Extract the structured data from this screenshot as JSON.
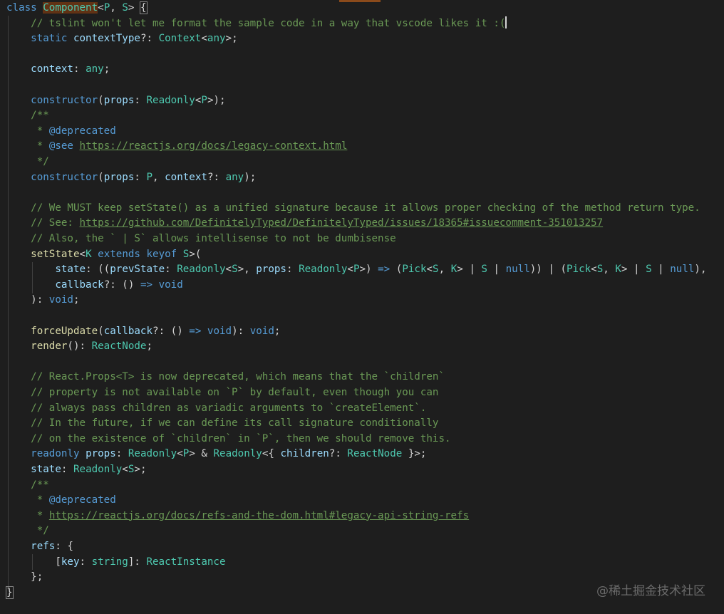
{
  "editor": {
    "lines": [
      [
        {
          "t": "class",
          "c": "kw"
        },
        {
          "t": " "
        },
        {
          "t": "Component",
          "c": "cls name-hl"
        },
        {
          "t": "<"
        },
        {
          "t": "P",
          "c": "cls"
        },
        {
          "t": ", "
        },
        {
          "t": "S",
          "c": "cls"
        },
        {
          "t": "> "
        },
        {
          "t": "{",
          "c": "bracket-box"
        }
      ],
      [
        {
          "t": "    "
        },
        {
          "t": "// tslint won't let me format the sample code in a way that vscode likes it :(",
          "c": "cm"
        },
        {
          "t": "",
          "caret": true
        }
      ],
      [
        {
          "t": "    "
        },
        {
          "t": "static",
          "c": "kw"
        },
        {
          "t": " "
        },
        {
          "t": "contextType",
          "c": "var"
        },
        {
          "t": "?: "
        },
        {
          "t": "Context",
          "c": "cls"
        },
        {
          "t": "<"
        },
        {
          "t": "any",
          "c": "cls"
        },
        {
          "t": ">;"
        }
      ],
      [],
      [
        {
          "t": "    "
        },
        {
          "t": "context",
          "c": "var"
        },
        {
          "t": ": "
        },
        {
          "t": "any",
          "c": "cls"
        },
        {
          "t": ";"
        }
      ],
      [],
      [
        {
          "t": "    "
        },
        {
          "t": "constructor",
          "c": "kw"
        },
        {
          "t": "("
        },
        {
          "t": "props",
          "c": "var"
        },
        {
          "t": ": "
        },
        {
          "t": "Readonly",
          "c": "cls"
        },
        {
          "t": "<"
        },
        {
          "t": "P",
          "c": "cls"
        },
        {
          "t": ">);"
        }
      ],
      [
        {
          "t": "    "
        },
        {
          "t": "/**",
          "c": "cm"
        }
      ],
      [
        {
          "t": "     "
        },
        {
          "t": "* ",
          "c": "cm"
        },
        {
          "t": "@deprecated",
          "c": "tag"
        }
      ],
      [
        {
          "t": "     "
        },
        {
          "t": "* ",
          "c": "cm"
        },
        {
          "t": "@see",
          "c": "tag"
        },
        {
          "t": " "
        },
        {
          "t": "https://reactjs.org/docs/legacy-context.html",
          "c": "url"
        }
      ],
      [
        {
          "t": "     "
        },
        {
          "t": "*/",
          "c": "cm"
        }
      ],
      [
        {
          "t": "    "
        },
        {
          "t": "constructor",
          "c": "kw"
        },
        {
          "t": "("
        },
        {
          "t": "props",
          "c": "var"
        },
        {
          "t": ": "
        },
        {
          "t": "P",
          "c": "cls"
        },
        {
          "t": ", "
        },
        {
          "t": "context",
          "c": "var"
        },
        {
          "t": "?: "
        },
        {
          "t": "any",
          "c": "cls"
        },
        {
          "t": ");"
        }
      ],
      [],
      [
        {
          "t": "    "
        },
        {
          "t": "// We MUST keep setState() as a unified signature because it allows proper checking of the method return type.",
          "c": "cm"
        }
      ],
      [
        {
          "t": "    "
        },
        {
          "t": "// See: ",
          "c": "cm"
        },
        {
          "t": "https://github.com/DefinitelyTyped/DefinitelyTyped/issues/18365#issuecomment-351013257",
          "c": "url"
        }
      ],
      [
        {
          "t": "    "
        },
        {
          "t": "// Also, the ` | S` allows intellisense to not be dumbisense",
          "c": "cm"
        }
      ],
      [
        {
          "t": "    "
        },
        {
          "t": "setState",
          "c": "fn"
        },
        {
          "t": "<"
        },
        {
          "t": "K",
          "c": "cls"
        },
        {
          "t": " "
        },
        {
          "t": "extends",
          "c": "kw"
        },
        {
          "t": " "
        },
        {
          "t": "keyof",
          "c": "kw"
        },
        {
          "t": " "
        },
        {
          "t": "S",
          "c": "cls"
        },
        {
          "t": ">("
        }
      ],
      [
        {
          "t": "        "
        },
        {
          "t": "state",
          "c": "var"
        },
        {
          "t": ": (("
        },
        {
          "t": "prevState",
          "c": "var"
        },
        {
          "t": ": "
        },
        {
          "t": "Readonly",
          "c": "cls"
        },
        {
          "t": "<"
        },
        {
          "t": "S",
          "c": "cls"
        },
        {
          "t": ">, "
        },
        {
          "t": "props",
          "c": "var"
        },
        {
          "t": ": "
        },
        {
          "t": "Readonly",
          "c": "cls"
        },
        {
          "t": "<"
        },
        {
          "t": "P",
          "c": "cls"
        },
        {
          "t": ">) "
        },
        {
          "t": "=>",
          "c": "kw"
        },
        {
          "t": " ("
        },
        {
          "t": "Pick",
          "c": "cls"
        },
        {
          "t": "<"
        },
        {
          "t": "S",
          "c": "cls"
        },
        {
          "t": ", "
        },
        {
          "t": "K",
          "c": "cls"
        },
        {
          "t": "> | "
        },
        {
          "t": "S",
          "c": "cls"
        },
        {
          "t": " | "
        },
        {
          "t": "null",
          "c": "kw"
        },
        {
          "t": ")) | ("
        },
        {
          "t": "Pick",
          "c": "cls"
        },
        {
          "t": "<"
        },
        {
          "t": "S",
          "c": "cls"
        },
        {
          "t": ", "
        },
        {
          "t": "K",
          "c": "cls"
        },
        {
          "t": "> | "
        },
        {
          "t": "S",
          "c": "cls"
        },
        {
          "t": " | "
        },
        {
          "t": "null",
          "c": "kw"
        },
        {
          "t": "),"
        }
      ],
      [
        {
          "t": "        "
        },
        {
          "t": "callback",
          "c": "var"
        },
        {
          "t": "?: () "
        },
        {
          "t": "=>",
          "c": "kw"
        },
        {
          "t": " "
        },
        {
          "t": "void",
          "c": "kw"
        }
      ],
      [
        {
          "t": "    ): "
        },
        {
          "t": "void",
          "c": "kw"
        },
        {
          "t": ";"
        }
      ],
      [],
      [
        {
          "t": "    "
        },
        {
          "t": "forceUpdate",
          "c": "fn"
        },
        {
          "t": "("
        },
        {
          "t": "callback",
          "c": "var"
        },
        {
          "t": "?: () "
        },
        {
          "t": "=>",
          "c": "kw"
        },
        {
          "t": " "
        },
        {
          "t": "void",
          "c": "kw"
        },
        {
          "t": "): "
        },
        {
          "t": "void",
          "c": "kw"
        },
        {
          "t": ";"
        }
      ],
      [
        {
          "t": "    "
        },
        {
          "t": "render",
          "c": "fn"
        },
        {
          "t": "(): "
        },
        {
          "t": "ReactNode",
          "c": "cls"
        },
        {
          "t": ";"
        }
      ],
      [],
      [
        {
          "t": "    "
        },
        {
          "t": "// React.Props<T> is now deprecated, which means that the `children`",
          "c": "cm"
        }
      ],
      [
        {
          "t": "    "
        },
        {
          "t": "// property is not available on `P` by default, even though you can",
          "c": "cm"
        }
      ],
      [
        {
          "t": "    "
        },
        {
          "t": "// always pass children as variadic arguments to `createElement`.",
          "c": "cm"
        }
      ],
      [
        {
          "t": "    "
        },
        {
          "t": "// In the future, if we can define its call signature conditionally",
          "c": "cm"
        }
      ],
      [
        {
          "t": "    "
        },
        {
          "t": "// on the existence of `children` in `P`, then we should remove this.",
          "c": "cm"
        }
      ],
      [
        {
          "t": "    "
        },
        {
          "t": "readonly",
          "c": "kw"
        },
        {
          "t": " "
        },
        {
          "t": "props",
          "c": "var"
        },
        {
          "t": ": "
        },
        {
          "t": "Readonly",
          "c": "cls"
        },
        {
          "t": "<"
        },
        {
          "t": "P",
          "c": "cls"
        },
        {
          "t": "> & "
        },
        {
          "t": "Readonly",
          "c": "cls"
        },
        {
          "t": "<{ "
        },
        {
          "t": "children",
          "c": "var"
        },
        {
          "t": "?: "
        },
        {
          "t": "ReactNode",
          "c": "cls"
        },
        {
          "t": " }>;"
        }
      ],
      [
        {
          "t": "    "
        },
        {
          "t": "state",
          "c": "var"
        },
        {
          "t": ": "
        },
        {
          "t": "Readonly",
          "c": "cls"
        },
        {
          "t": "<"
        },
        {
          "t": "S",
          "c": "cls"
        },
        {
          "t": ">;"
        }
      ],
      [
        {
          "t": "    "
        },
        {
          "t": "/**",
          "c": "cm"
        }
      ],
      [
        {
          "t": "     "
        },
        {
          "t": "* ",
          "c": "cm"
        },
        {
          "t": "@deprecated",
          "c": "tag"
        }
      ],
      [
        {
          "t": "     "
        },
        {
          "t": "* ",
          "c": "cm"
        },
        {
          "t": "https://reactjs.org/docs/refs-and-the-dom.html#legacy-api-string-refs",
          "c": "url"
        }
      ],
      [
        {
          "t": "     "
        },
        {
          "t": "*/",
          "c": "cm"
        }
      ],
      [
        {
          "t": "    "
        },
        {
          "t": "refs",
          "c": "var"
        },
        {
          "t": ": {"
        }
      ],
      [
        {
          "t": "        ["
        },
        {
          "t": "key",
          "c": "var"
        },
        {
          "t": ": "
        },
        {
          "t": "string",
          "c": "cls"
        },
        {
          "t": "]: "
        },
        {
          "t": "ReactInstance",
          "c": "cls"
        }
      ],
      [
        {
          "t": "    };"
        }
      ],
      [
        {
          "t": "}",
          "c": "bracket-box"
        }
      ]
    ]
  },
  "watermark": {
    "text": "@稀土掘金技术社区"
  }
}
